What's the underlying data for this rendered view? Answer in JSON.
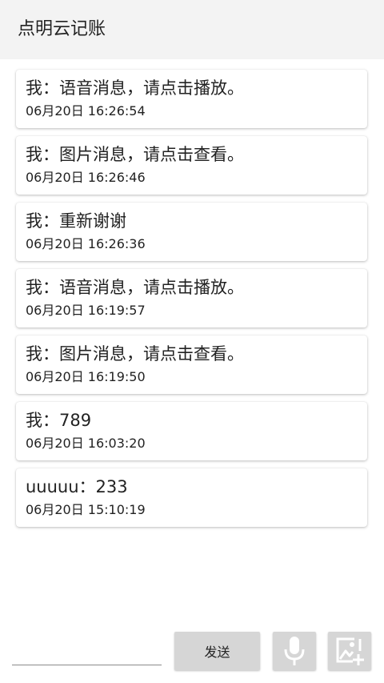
{
  "app": {
    "title": "点明云记账"
  },
  "messages": [
    {
      "text": "我：语音消息，请点击播放。",
      "time": "06月20日 16:26:54"
    },
    {
      "text": "我：图片消息，请点击查看。",
      "time": "06月20日 16:26:46"
    },
    {
      "text": "我：重新谢谢",
      "time": "06月20日 16:26:36"
    },
    {
      "text": "我：语音消息，请点击播放。",
      "time": "06月20日 16:19:57"
    },
    {
      "text": "我：图片消息，请点击查看。",
      "time": "06月20日 16:19:50"
    },
    {
      "text": "我：789",
      "time": "06月20日 16:03:20"
    },
    {
      "text": "uuuuu：233",
      "time": "06月20日 15:10:19"
    }
  ],
  "composer": {
    "input_value": "",
    "send_label": "发送",
    "voice_icon": "microphone-icon",
    "image_icon": "add-image-icon"
  },
  "colors": {
    "app_bar": "#f3f3f3",
    "button_bg": "#d6d6d6",
    "icon_white": "#ffffff"
  }
}
